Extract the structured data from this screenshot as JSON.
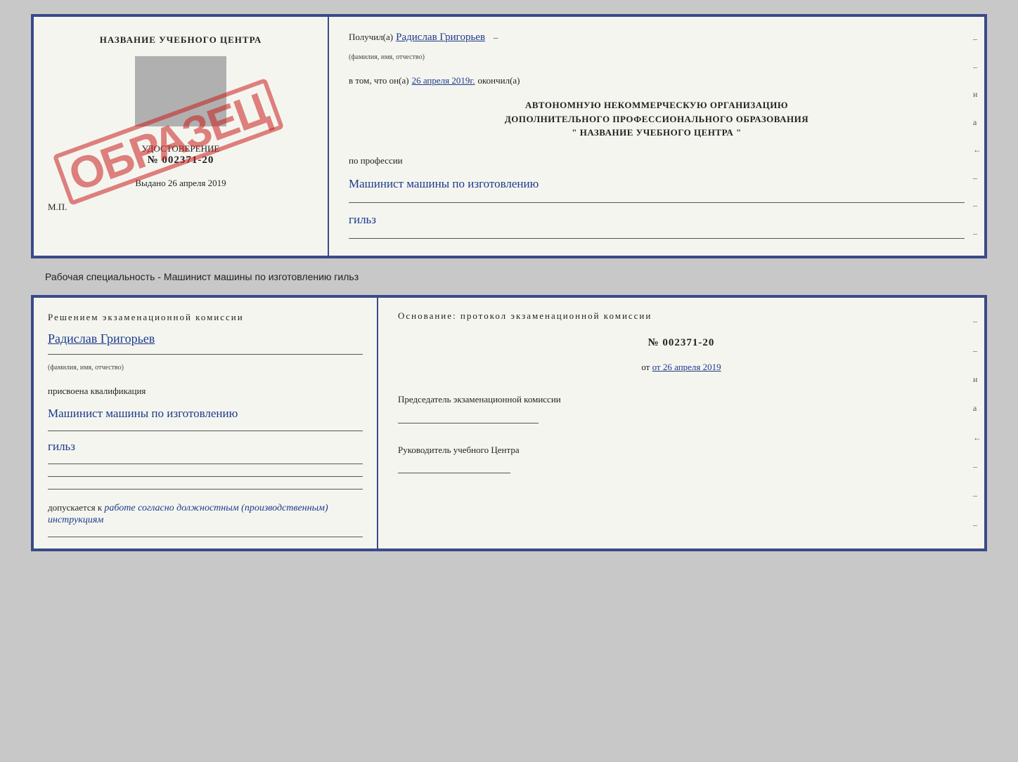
{
  "top_doc": {
    "left": {
      "center_title": "НАЗВАНИЕ УЧЕБНОГО ЦЕНТРА",
      "stamp_label": "УДОСТОВЕРЕНИЕ",
      "stamp_number": "№ 002371-20",
      "obrazec": "ОБРАЗЕЦ",
      "vydano": "Выдано 26 апреля 2019",
      "mp": "М.П."
    },
    "right": {
      "poluchil_prefix": "Получил(а)",
      "poluchil_name": "Радислав Григорьев",
      "fio_label": "(фамилия, имя, отчество)",
      "v_tom_prefix": "в том, что он(а)",
      "v_tom_date": "26 апреля 2019г.",
      "okončil": "окончил(а)",
      "block_line1": "АВТОНОМНУЮ НЕКОММЕРЧЕСКУЮ ОРГАНИЗАЦИЮ",
      "block_line2": "ДОПОЛНИТЕЛЬНОГО ПРОФЕССИОНАЛЬНОГО ОБРАЗОВАНИЯ",
      "block_line3": "\"  НАЗВАНИЕ УЧЕБНОГО ЦЕНТРА  \"",
      "po_professii": "по профессии",
      "profession1": "Машинист машины по изготовлению",
      "profession2": "гильз"
    }
  },
  "caption": "Рабочая специальность - Машинист машины по изготовлению гильз",
  "bottom_doc": {
    "left": {
      "resheniem": "Решением  экзаменационной  комиссии",
      "name": "Радислав Григорьев",
      "fio_label": "(фамилия, имя, отчество)",
      "prisvoena": "присвоена квалификация",
      "profession1": "Машинист машины по изготовлению",
      "profession2": "гильз",
      "dopuskaetsya": "допускается к",
      "dopusk_text": "работе согласно должностным (производственным) инструкциям"
    },
    "right": {
      "osnovanie": "Основание: протокол экзаменационной  комиссии",
      "number": "№  002371-20",
      "ot": "от 26 апреля 2019",
      "chairman_label": "Председатель экзаменационной комиссии",
      "rukovoditel_label": "Руководитель учебного Центра"
    }
  },
  "side_chars": [
    "–",
    "–",
    "и",
    "а",
    "←",
    "–",
    "–",
    "–"
  ]
}
